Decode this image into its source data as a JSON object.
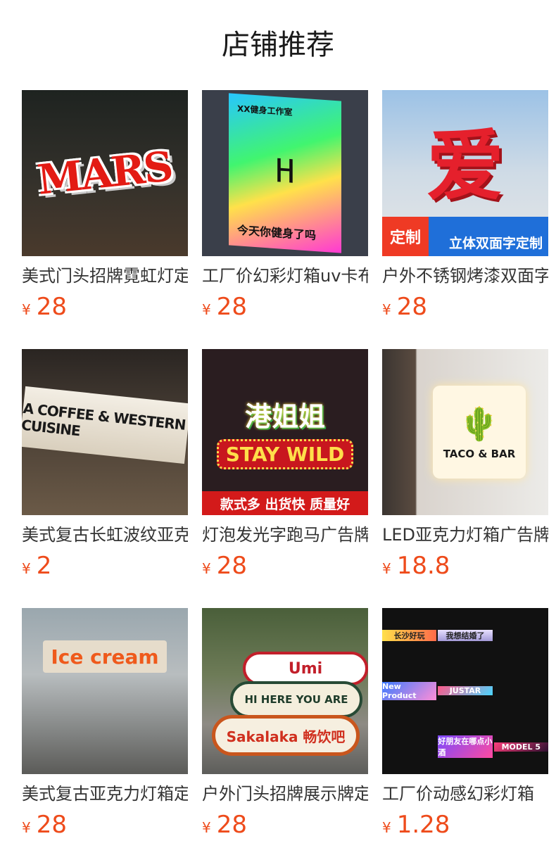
{
  "section": {
    "title": "店铺推荐"
  },
  "currency": "¥",
  "products": [
    {
      "name": "美式门头招牌霓虹灯定制",
      "price": "28",
      "thumb": {
        "word": "MARS"
      }
    },
    {
      "name": "工厂价幻彩灯箱uv卡布灯箱",
      "price": "28",
      "thumb": {
        "top": "XX健身工作室",
        "logo": "H",
        "bottom": "今天你健身了吗"
      }
    },
    {
      "name": "户外不锈钢烤漆双面字定制",
      "price": "28",
      "thumb": {
        "word": "爱",
        "tag": "定制",
        "banner": "立体双面字定制"
      }
    },
    {
      "name": "美式复古长虹波纹亚克力灯箱",
      "price": "2",
      "thumb": {
        "board": "A COFFEE & WESTERN CUISINE"
      }
    },
    {
      "name": "灯泡发光字跑马广告牌定制",
      "price": "28",
      "thumb": {
        "a": "港姐姐",
        "b": "STAY WILD",
        "strip": "款式多  出货快  质量好"
      }
    },
    {
      "name": "LED亚克力灯箱广告牌定制",
      "price": "18.8",
      "thumb": {
        "cactus": "🌵",
        "text": "TACO & BAR"
      }
    },
    {
      "name": "美式复古亚克力灯箱定制",
      "price": "28",
      "thumb": {
        "sign": "Ice cream"
      }
    },
    {
      "name": "户外门头招牌展示牌定制",
      "price": "28",
      "thumb": {
        "s1": "Umi",
        "s2": "HI HERE YOU ARE",
        "s3": "Sakalaka 畅饮吧"
      }
    },
    {
      "name": "工厂价动感幻彩灯箱",
      "price": "1.28",
      "thumb": {
        "tiles": [
          "长沙好玩",
          "我想结婚了",
          "",
          "New Product",
          "JUSTAR",
          "",
          "",
          "好朋友在哪点小酒",
          "MODEL 5"
        ]
      }
    }
  ],
  "colors": {
    "price": "#ee4b1b",
    "title": "#1a1a1a",
    "name": "#333333"
  }
}
